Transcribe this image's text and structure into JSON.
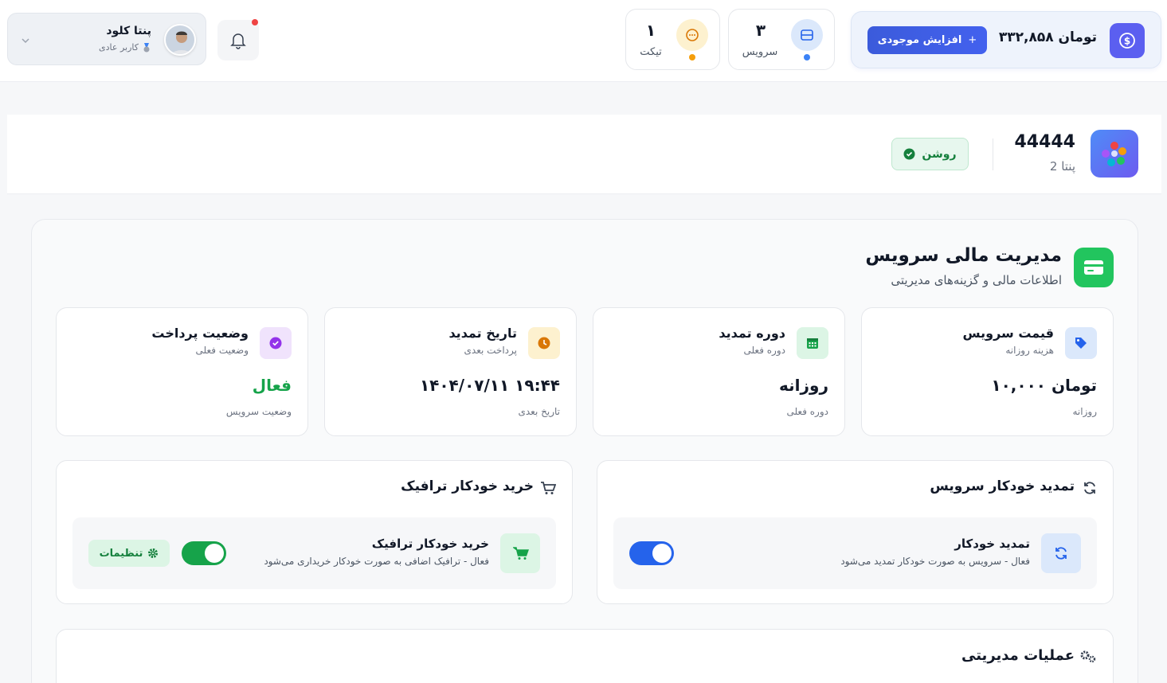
{
  "user": {
    "name": "پنتا کلود",
    "role": "کاربر عادی"
  },
  "stats": [
    {
      "value": "۱",
      "label": "تیکت",
      "color": "#f59e0b"
    },
    {
      "value": "۳",
      "label": "سرویس",
      "color": "#3b82f6"
    }
  ],
  "wallet": {
    "balance": "۳۳۲,۸۵۸ تومان",
    "button_label": "افزایش موجودی"
  },
  "service": {
    "name": "44444",
    "subtitle": "پنتا 2",
    "status": "روشن"
  },
  "finance": {
    "title": "مدیریت مالی سرویس",
    "subtitle": "اطلاعات مالی و گزینه‌های مدیریتی",
    "cards": [
      {
        "title": "قیمت سرویس",
        "subtitle": "هزینه روزانه",
        "value": "۱۰,۰۰۰ تومان",
        "footer": "روزانه",
        "color": "#3b82f6"
      },
      {
        "title": "دوره تمدید",
        "subtitle": "دوره فعلی",
        "value": "روزانه",
        "footer": "دوره فعلی",
        "color": "#16a34a"
      },
      {
        "title": "تاریخ تمدید",
        "subtitle": "پرداخت بعدی",
        "value": "۱۴۰۴/۰۷/۱۱ ۱۹:۴۴",
        "footer": "تاریخ بعدی",
        "color": "#d97706"
      },
      {
        "title": "وضعیت پرداخت",
        "subtitle": "وضعیت فعلی",
        "value": "فعال",
        "footer": "وضعیت سرویس",
        "color": "#9333ea"
      }
    ]
  },
  "auto_renew": {
    "title": "تمدید خودکار سرویس",
    "item_title": "تمدید خودکار",
    "item_desc": "فعال - سرویس به صورت خودکار تمدید می‌شود",
    "enabled": true
  },
  "auto_traffic": {
    "title": "خرید خودکار ترافیک",
    "item_title": "خرید خودکار ترافیک",
    "item_desc": "فعال - ترافیک اضافی به صورت خودکار خریداری می‌شود",
    "enabled": true,
    "settings_label": "تنظیمات"
  },
  "operations": {
    "title": "عملیات مدیریتی"
  }
}
